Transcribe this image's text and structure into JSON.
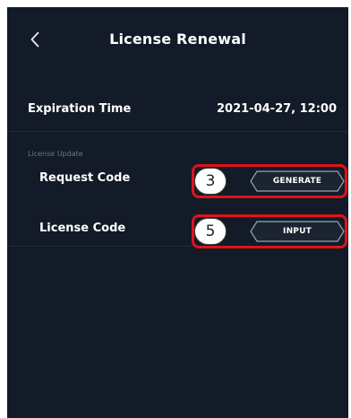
{
  "header": {
    "title": "License Renewal",
    "back_icon": "chevron-left-icon"
  },
  "expiration": {
    "label": "Expiration Time",
    "value": "2021-04-27, 12:00"
  },
  "license_update": {
    "section_label": "License Update",
    "request_code": {
      "label": "Request Code",
      "button_label": "GENERATE",
      "step_number": "3"
    },
    "license_code": {
      "label": "License Code",
      "button_label": "INPUT",
      "step_number": "5"
    }
  },
  "colors": {
    "background": "#121b27",
    "highlight": "#e0121b",
    "button_border": "#9aa5b2"
  }
}
